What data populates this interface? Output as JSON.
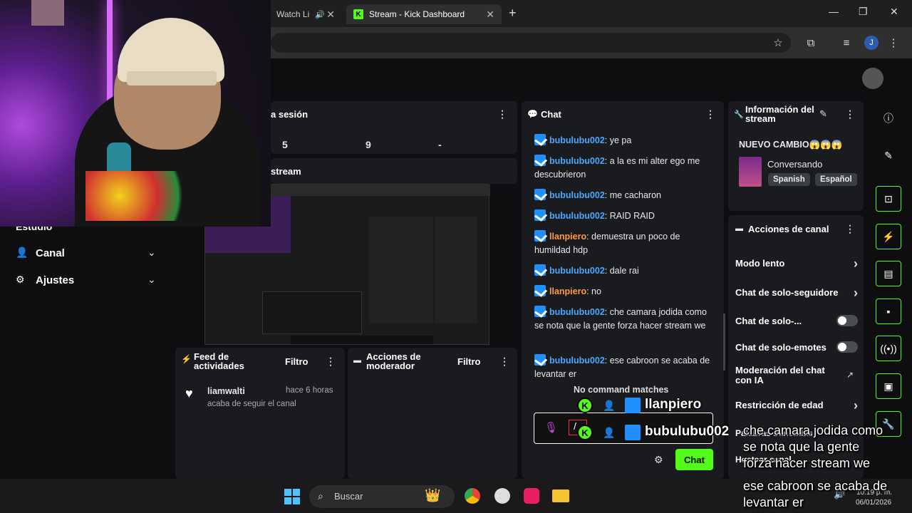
{
  "browser": {
    "tabs": [
      {
        "label": "Watch Li"
      },
      {
        "label": "Stream - Kick Dashboard"
      }
    ],
    "new_tab": "+",
    "profile_initial": "J"
  },
  "dashboard": {
    "session_panel": {
      "title": "a sesión",
      "stats": [
        "5",
        "9",
        "-"
      ]
    },
    "stream_panel": {
      "title": "stream"
    },
    "nav": [
      {
        "label": "Estudio"
      },
      {
        "label": "Canal"
      },
      {
        "label": "Ajustes"
      }
    ],
    "activity_feed": {
      "title": "Feed de actividades",
      "filter": "Filtro",
      "item": {
        "user": "liamwalti",
        "time": "hace 6 horas",
        "text": "acaba de seguir el canal"
      }
    },
    "mod_actions": {
      "title": "Acciones de moderador",
      "filter": "Filtro"
    },
    "chat": {
      "title": "Chat",
      "messages": [
        {
          "user": "bubulubu002",
          "text": "ye pa",
          "color": "#4aa8ff"
        },
        {
          "user": "bubulubu002",
          "text": "a la es mi alter ego me descubrieron",
          "color": "#4aa8ff"
        },
        {
          "user": "bubulubu002",
          "text": "me cacharon",
          "color": "#4aa8ff"
        },
        {
          "user": "bubulubu002",
          "text": "RAID RAID",
          "color": "#4aa8ff"
        },
        {
          "user": "llanpiero",
          "text": "demuestra un poco de humildad hdp",
          "color": "#ff9a3c"
        },
        {
          "user": "bubulubu002",
          "text": "dale rai",
          "color": "#4aa8ff"
        },
        {
          "user": "llanpiero",
          "text": "no",
          "color": "#ff9a3c"
        },
        {
          "user": "bubulubu002",
          "text": "che camara jodida como se nota que la gente forza hacer stream we",
          "color": "#4aa8ff"
        },
        {
          "user": "bubulubu002",
          "text": "ese cabroon se acaba de levantar er",
          "color": "#4aa8ff"
        }
      ],
      "no_command": "No command matches",
      "input_value": "/",
      "send_label": "Chat"
    },
    "stream_info": {
      "title": "Información del stream",
      "stream_title": "NUEVO CAMBIO😱😱😱",
      "category": "Conversando",
      "tags": [
        "Spanish",
        "Español"
      ]
    },
    "channel_actions": {
      "title": "Acciones de canal",
      "items": [
        {
          "label": "Modo lento",
          "control": "chevron"
        },
        {
          "label": "Chat de solo-seguidore",
          "control": "chevron"
        },
        {
          "label": "Chat de solo-...",
          "control": "toggle"
        },
        {
          "label": "Chat de solo-emotes",
          "control": "toggle"
        },
        {
          "label": "Moderación del chat con IA",
          "control": "external"
        },
        {
          "label": "Restricción de edad",
          "control": "chevron"
        },
        {
          "label": "Palabras baneadas",
          "control": "none"
        },
        {
          "label": "Hostear canal",
          "control": "none"
        }
      ]
    }
  },
  "overlay": {
    "usernames": [
      "llanpiero",
      "bubulubu002",
      "bubulubu002"
    ],
    "subtitles": [
      "che camara jodida como",
      "se nota que la gente",
      "forza hacer stream we",
      "ese cabroon se acaba de",
      "levantar er"
    ]
  },
  "taskbar": {
    "search_placeholder": "Buscar",
    "time": "10:19 p. m.",
    "date": "06/01/2026"
  },
  "colors": {
    "accent": "#53fc18",
    "link": "#4aa8ff"
  }
}
